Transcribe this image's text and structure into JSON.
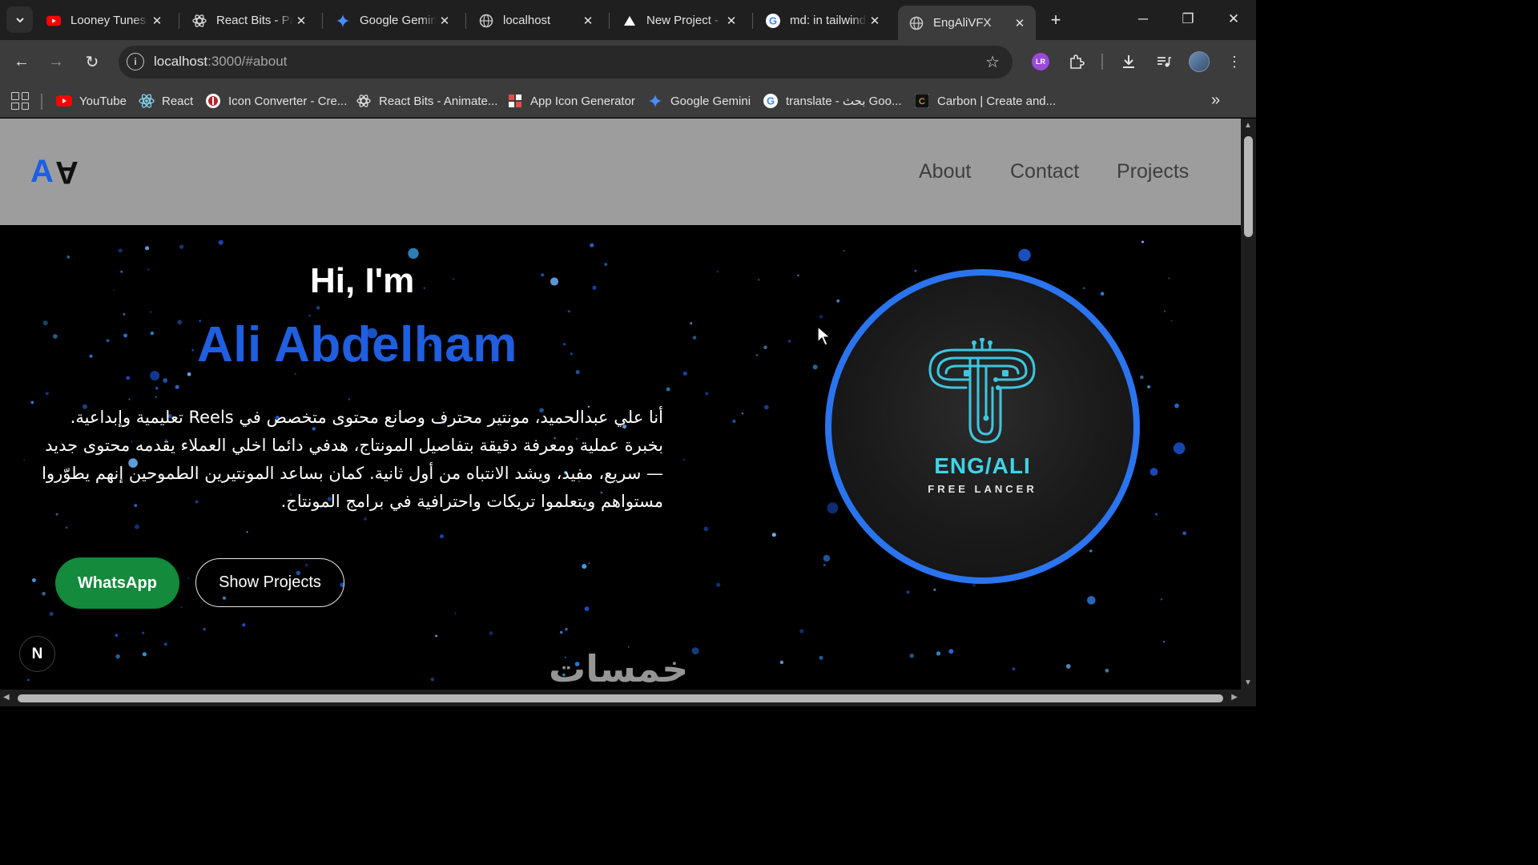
{
  "browser": {
    "tabs": [
      {
        "title": "Looney Tunes",
        "icon": "youtube-icon"
      },
      {
        "title": "React Bits - Pa",
        "icon": "react-bits-icon"
      },
      {
        "title": "Google Gemini",
        "icon": "gemini-icon"
      },
      {
        "title": "localhost",
        "icon": "globe-icon"
      },
      {
        "title": "New Project -",
        "icon": "triangle-icon"
      },
      {
        "title": "md: in tailwind",
        "icon": "google-icon"
      },
      {
        "title": "EngAliVFX",
        "icon": "globe-icon",
        "active": true
      }
    ],
    "url_host": "localhost",
    "url_rest": ":3000/#about",
    "extension_label": "LR",
    "bookmarks": [
      {
        "label": "YouTube",
        "icon": "youtube-icon"
      },
      {
        "label": "React",
        "icon": "react-icon"
      },
      {
        "label": "Icon Converter - Cre...",
        "icon": "icon-converter-icon"
      },
      {
        "label": "React Bits - Animate...",
        "icon": "react-bits-icon"
      },
      {
        "label": "App Icon Generator",
        "icon": "app-icon-generator-icon"
      },
      {
        "label": "Google Gemini",
        "icon": "gemini-icon"
      },
      {
        "label": "translate - بحث Goo...",
        "icon": "google-icon"
      },
      {
        "label": "Carbon | Create and...",
        "icon": "carbon-icon"
      }
    ]
  },
  "site": {
    "logo_a": "A",
    "logo_b": "A",
    "nav": [
      "About",
      "Contact",
      "Projects"
    ],
    "hero": {
      "greeting": "Hi, I'm",
      "name": "Ali Abdelham",
      "bio": "أنا علي عبدالحميد، مونتير محترف وصانع محتوى متخصص في Reels تعليمية وإبداعية. بخبرة عملية ومعرفة دقيقة بتفاصيل المونتاج، هدفي دائما اخلي العملاء يقدمه محتوى جديد — سريع، مفيد، ويشد الانتباه من أول ثانية. كمان بساعد المونتيرين الطموحين إنهم يطوّروا مستواهم ويتعلموا تريكات واحترافية في برامج المونتاج.",
      "whatsapp_label": "WhatsApp",
      "projects_label": "Show Projects"
    },
    "avatar": {
      "title": "ENG/ALI",
      "subtitle": "FREE LANCER"
    },
    "dev_badge": "N",
    "watermark": "خمسات"
  },
  "colors": {
    "accent_blue": "#1f5fe0",
    "ring_blue": "#2b74f0",
    "whatsapp_green": "#138a3c",
    "navbar_grey": "#9d9d9d",
    "logo_cyan": "#3fd4e8"
  }
}
